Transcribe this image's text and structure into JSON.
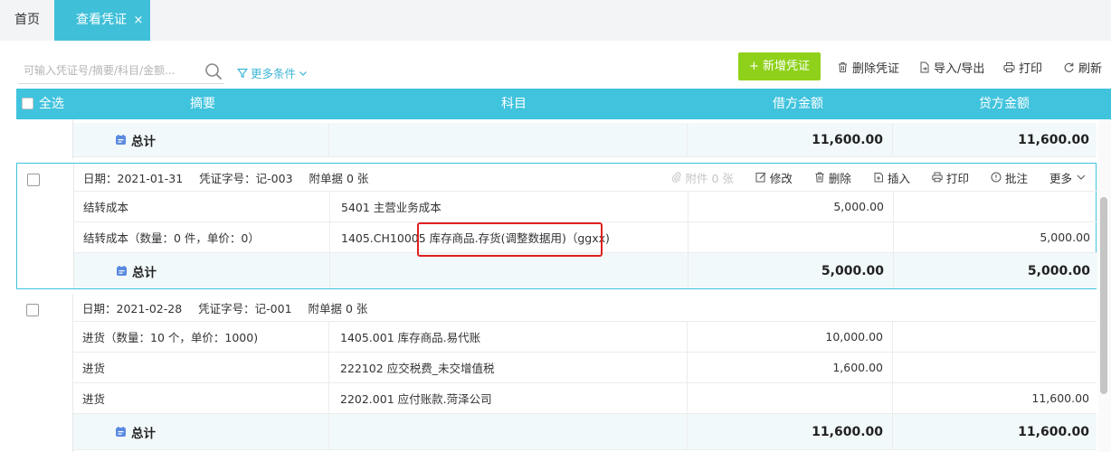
{
  "tabs": {
    "home": "首页",
    "active": "查看凭证",
    "close": "×"
  },
  "toolbar": {
    "search_placeholder": "可输入凭证号/摘要/科目/金额...",
    "more_conditions": "更多条件",
    "add_voucher": "+ 新增凭证",
    "delete_voucher": "删除凭证",
    "import_export": "导入/导出",
    "print": "打印",
    "refresh": "刷新"
  },
  "table": {
    "headers": {
      "select_all": "全选",
      "summary": "摘要",
      "subject": "科目",
      "debit": "借方金额",
      "credit": "贷方金额"
    },
    "total_label": "总计",
    "ops": {
      "attachments": "附件 0 张",
      "edit": "修改",
      "delete": "删除",
      "insert": "插入",
      "print": "打印",
      "annotate": "批注",
      "more": "更多"
    },
    "top_total": {
      "debit": "11,600.00",
      "credit": "11,600.00"
    },
    "vouchers": [
      {
        "date": "日期：2021-01-31",
        "number": "凭证字号：记-003",
        "attachments": "附单据 0 张",
        "entries": [
          {
            "summary": "结转成本",
            "subject": "5401 主营业务成本",
            "debit": "5,000.00",
            "credit": ""
          },
          {
            "summary": "结转成本（数量：0 件，单价：0）",
            "subject": "1405.CH10005 库存商品.存货(调整数据用)（ggxx)",
            "debit": "",
            "credit": "5,000.00"
          }
        ],
        "total": {
          "debit": "5,000.00",
          "credit": "5,000.00"
        }
      },
      {
        "date": "日期：2021-02-28",
        "number": "凭证字号：记-001",
        "attachments": "附单据 0 张",
        "entries": [
          {
            "summary": "进货（数量：10 个，单价：1000)",
            "subject": "1405.001  库存商品.易代账",
            "debit": "10,000.00",
            "credit": ""
          },
          {
            "summary": "进货",
            "subject": "222102 应交税费_未交增值税",
            "debit": "1,600.00",
            "credit": ""
          },
          {
            "summary": "进货",
            "subject": "2202.001  应付账款.菏泽公司",
            "debit": "",
            "credit": "11,600.00"
          }
        ],
        "total": {
          "debit": "11,600.00",
          "credit": "11,600.00"
        }
      }
    ]
  },
  "colors": {
    "accent": "#40c3dd",
    "add_button": "#8fd11a",
    "highlight_box": "#e02020"
  },
  "icons": {
    "search": "search-icon",
    "filter": "filter-icon",
    "trash": "trash-icon",
    "import": "import-icon",
    "printer": "printer-icon",
    "refresh": "refresh-icon",
    "calendar": "calendar-icon"
  }
}
